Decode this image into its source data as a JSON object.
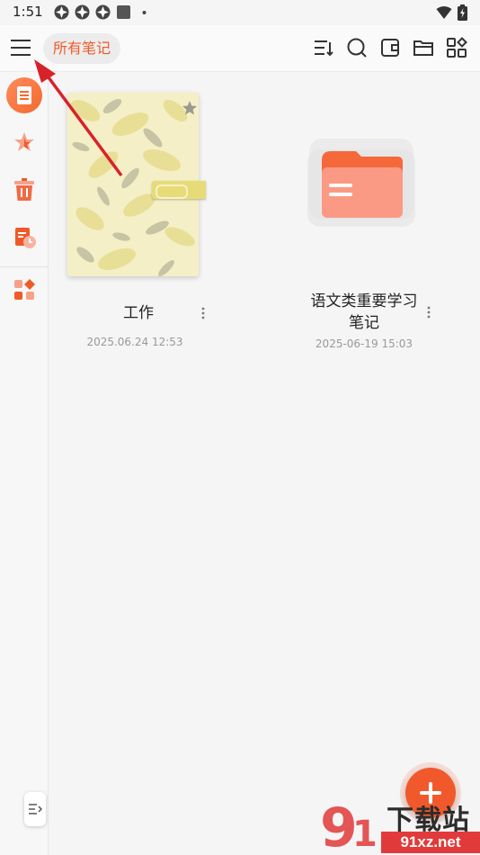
{
  "status_bar": {
    "time": "1:51",
    "icons": [
      "notification-pinwheel-icon",
      "notification-pinwheel-icon",
      "notification-pinwheel-icon",
      "notification-square-icon",
      "dot-icon"
    ],
    "right_icons": [
      "wifi-icon",
      "battery-icon"
    ]
  },
  "header": {
    "title": "所有笔记",
    "toolbar": [
      "sort-icon",
      "search-icon",
      "wallet-icon",
      "folder-icon",
      "grid-icon"
    ]
  },
  "sidebar": {
    "items": [
      "all-notes-icon",
      "favorites-icon",
      "trash-icon",
      "recent-icon",
      "apps-icon"
    ],
    "active_index": 0
  },
  "notes": [
    {
      "title": "工作",
      "date": "2025.06.24 12:53",
      "type": "notebook",
      "favorite": true
    },
    {
      "title": "语文类重要学习笔记",
      "date": "2025-06-19 15:03",
      "type": "folder"
    }
  ],
  "watermark": {
    "text": "下载站",
    "url": "91xz.net"
  },
  "colors": {
    "accent": "#f1592c",
    "folder": "#f88a72",
    "background": "#f5f5f5"
  }
}
